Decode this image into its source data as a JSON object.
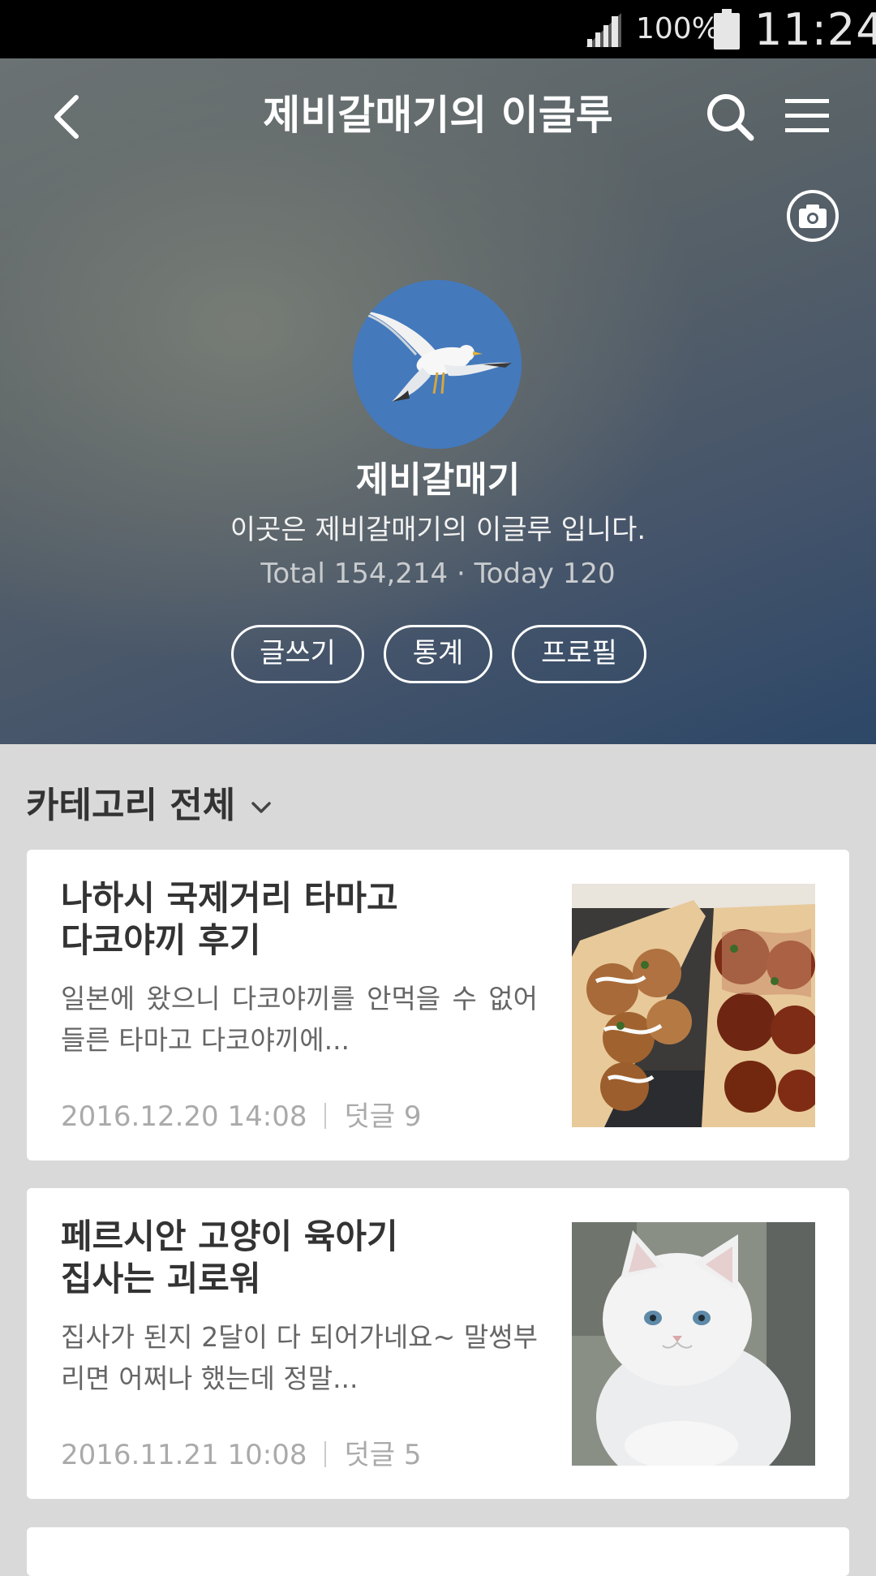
{
  "status_bar": {
    "battery_percent": "100%",
    "time": "11:24",
    "icons": [
      "signal-icon",
      "battery-icon"
    ]
  },
  "header": {
    "title": "제비갈매기의 이글루",
    "icons": [
      "back-arrow-icon",
      "search-icon",
      "menu-icon",
      "camera-icon"
    ]
  },
  "profile": {
    "name": "제비갈매기",
    "description": "이곳은 제비갈매기의 이글루 입니다.",
    "stats": "Total 154,214 · Today 120",
    "buttons": {
      "write": "글쓰기",
      "statistics": "통계",
      "profile": "프로필"
    }
  },
  "category": {
    "label": "카테고리 전체"
  },
  "posts": [
    {
      "title": "나하시 국제거리 타마고\n다코야끼 후기",
      "excerpt": "일본에 왔으니 다코야끼를 안먹을 수 없어 들른 타마고 다코야끼에...",
      "date": "2016.12.20 14:08",
      "comments": "덧글 9",
      "thumbnail": "takoyaki-photo"
    },
    {
      "title": "페르시안 고양이 육아기\n집사는 괴로워",
      "excerpt": "집사가 된지 2달이 다 되어가네요~ 말썽부리면 어쩌나 했는데 정말...",
      "date": "2016.11.21 10:08",
      "comments": "덧글 5",
      "thumbnail": "white-kitten-photo"
    }
  ],
  "colors": {
    "status_bar_bg": "#000000",
    "page_bg": "#d9d9d9",
    "card_bg": "#ffffff",
    "hero_gradient_end": "#2d4768",
    "avatar_bg": "#4479bc",
    "meta_text": "#aaaaaa"
  }
}
